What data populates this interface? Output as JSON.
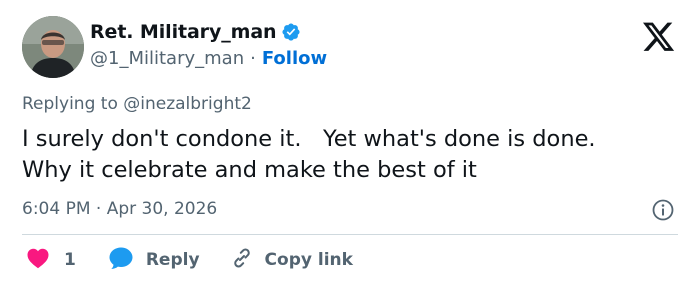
{
  "author": {
    "display_name": "Ret. Military_man",
    "handle": "@1_Military_man",
    "separator": "·",
    "follow_label": "Follow",
    "verified": true
  },
  "reply_context": {
    "prefix": "Replying to",
    "mention": "@inezalbright2"
  },
  "tweet": {
    "text": "I surely don't condone it.   Yet what's done is done.\nWhy it celebrate and make the best of it",
    "timestamp": "6:04 PM · Apr 30, 2026"
  },
  "actions": {
    "like_count": "1",
    "reply_label": "Reply",
    "copy_link_label": "Copy link"
  },
  "colors": {
    "like": "#f91880",
    "reply": "#1d9bf0",
    "follow": "#006fd6",
    "muted": "#536471",
    "verified": "#1d9bf0"
  },
  "icons": [
    "avatar",
    "verified-badge-icon",
    "x-logo-icon",
    "info-icon",
    "heart-icon",
    "reply-bubble-icon",
    "link-icon"
  ]
}
